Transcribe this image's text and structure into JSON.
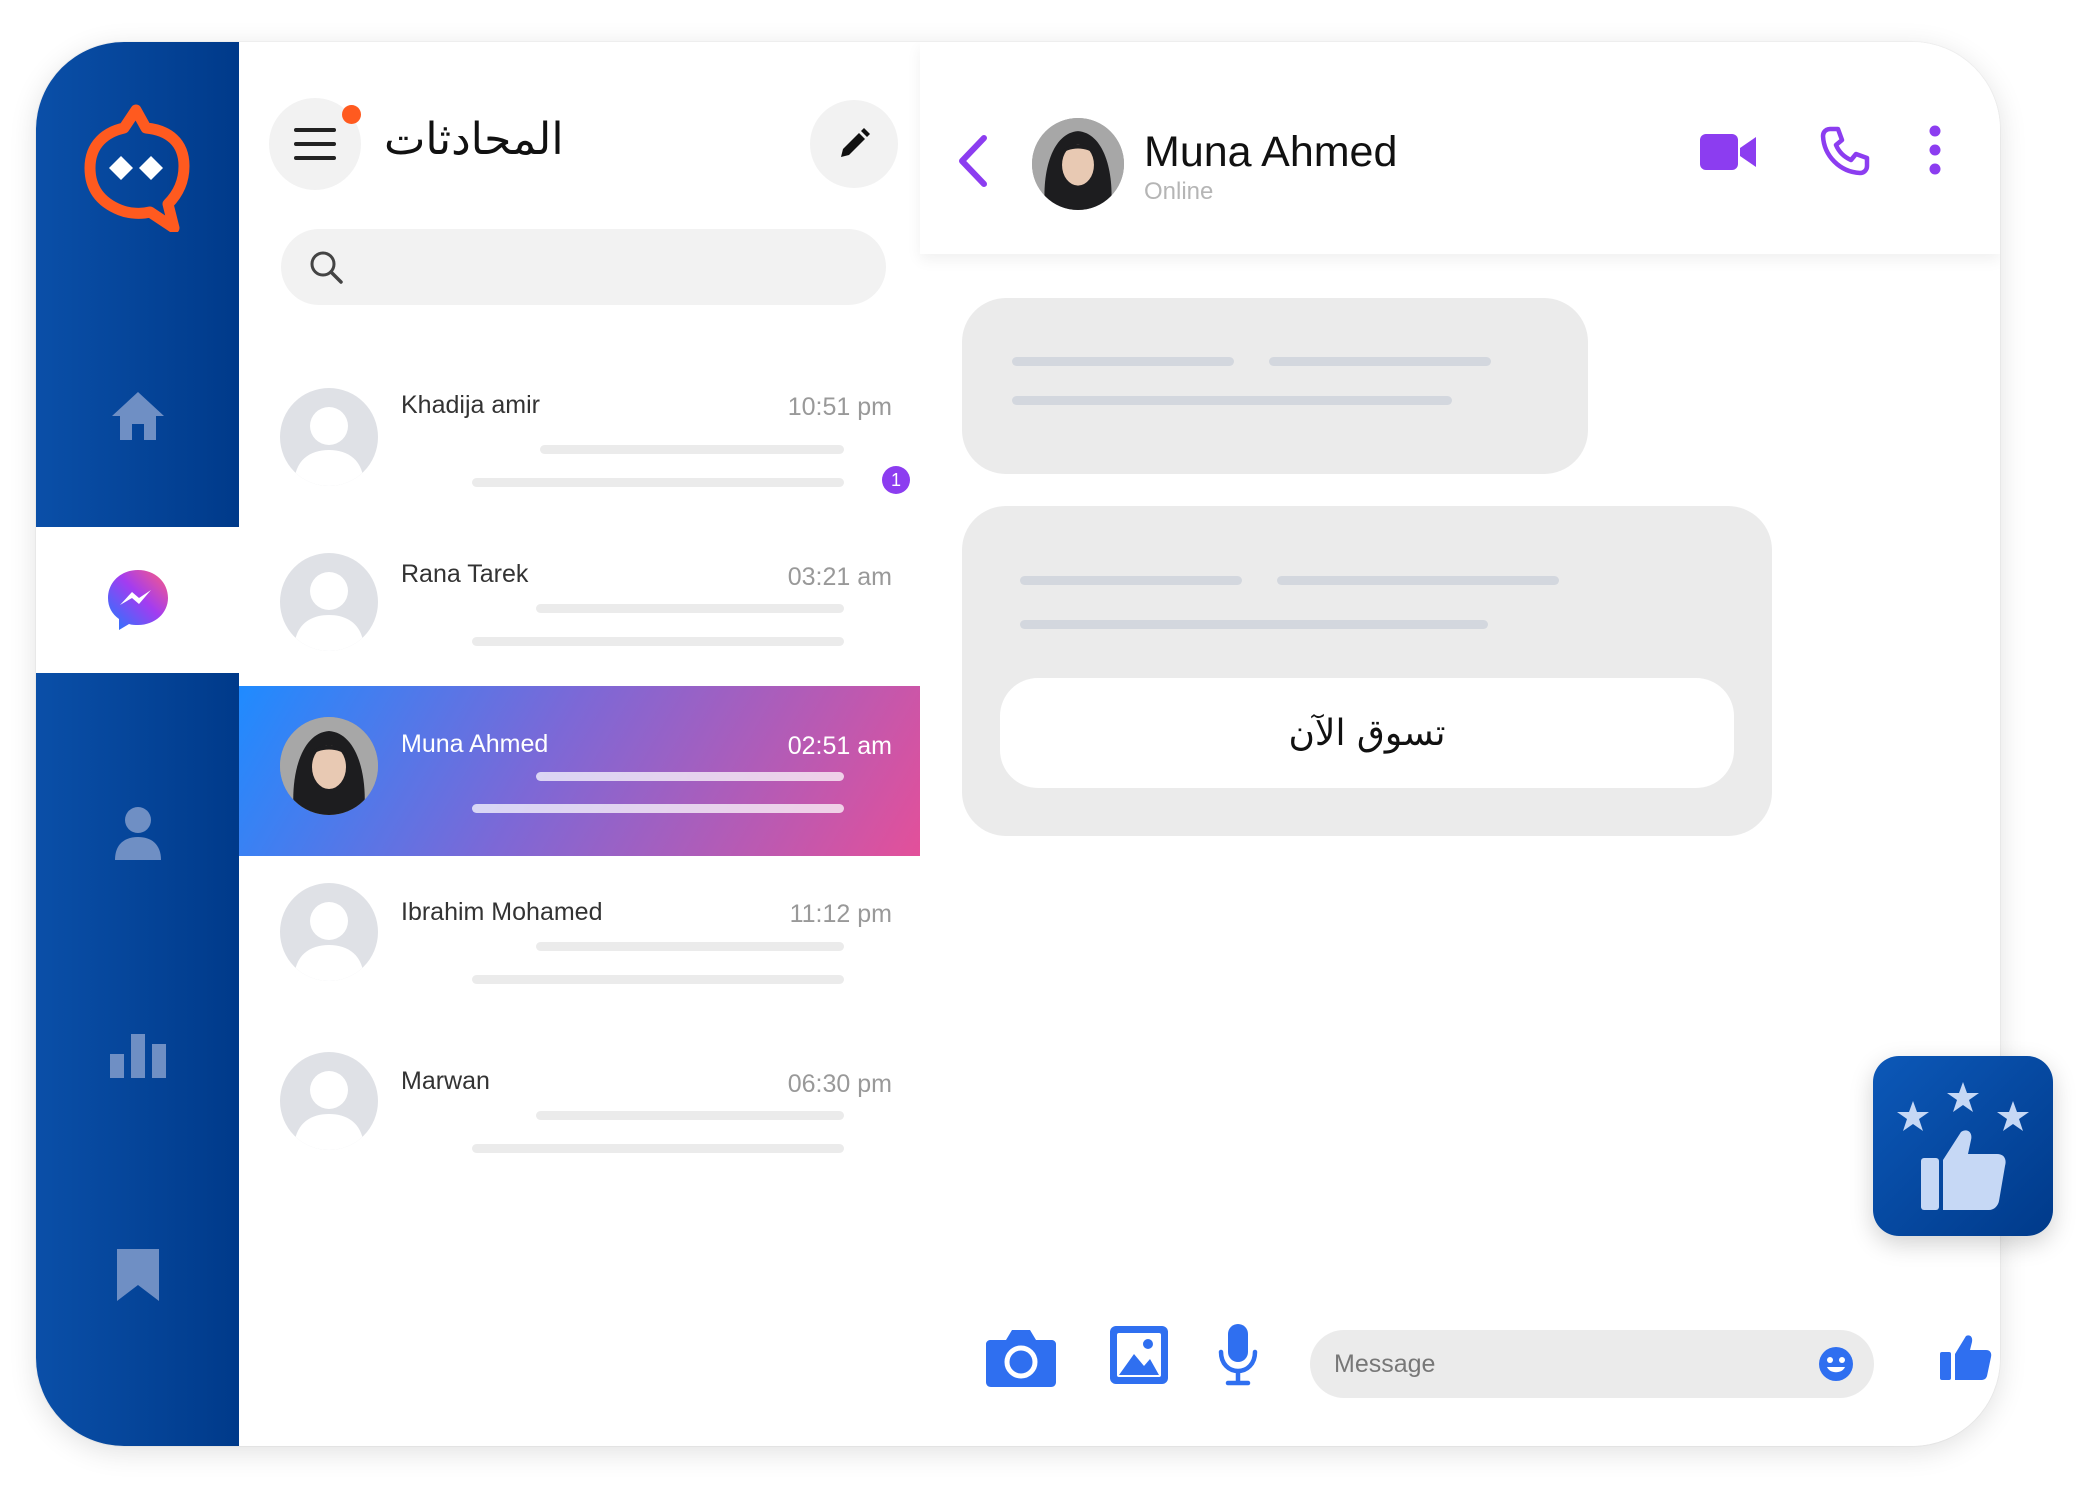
{
  "colors": {
    "rail_blue": "#0a4fa8",
    "accent_purple": "#8c3df0",
    "logo_orange": "#ff5a1f",
    "action_blue": "#2f6ff0"
  },
  "rail": {
    "items": [
      {
        "icon": "home-icon",
        "active": false
      },
      {
        "icon": "messenger-icon",
        "active": true
      },
      {
        "icon": "user-icon",
        "active": false
      },
      {
        "icon": "bar-chart-icon",
        "active": false
      },
      {
        "icon": "bookmark-icon",
        "active": false
      }
    ]
  },
  "list": {
    "title": "المحادثات",
    "search_placeholder": "",
    "chats": [
      {
        "name": "Khadija amir",
        "time": "10:51 pm",
        "unread": "1",
        "active": false
      },
      {
        "name": "Rana Tarek",
        "time": "03:21 am",
        "active": false
      },
      {
        "name": "Muna Ahmed",
        "time": "02:51 am",
        "active": true
      },
      {
        "name": "Ibrahim Mohamed",
        "time": "11:12 pm",
        "active": false
      },
      {
        "name": "Marwan",
        "time": "06:30 pm",
        "active": false
      }
    ]
  },
  "chat": {
    "contact_name": "Muna Ahmed",
    "status": "Online",
    "shop_button": "تسوق الآن",
    "message_placeholder": "Message"
  }
}
